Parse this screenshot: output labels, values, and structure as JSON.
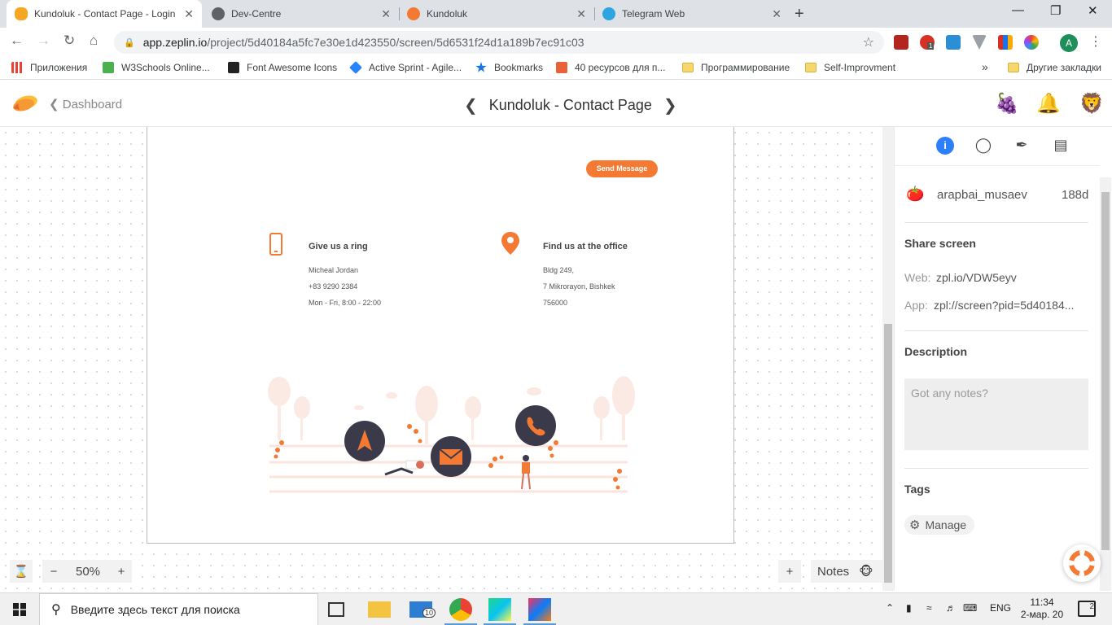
{
  "browser": {
    "tabs": [
      {
        "title": "Kundoluk - Contact Page - Login",
        "close": "✕",
        "active": true
      },
      {
        "title": "Dev-Centre",
        "close": "✕",
        "active": false
      },
      {
        "title": "Kundoluk",
        "close": "✕",
        "active": false
      },
      {
        "title": "Telegram Web",
        "close": "✕",
        "active": false
      }
    ],
    "new_tab": "+",
    "window_controls": {
      "minimize": "—",
      "maximize": "❐",
      "close": "✕"
    },
    "url_host": "app.zeplin.io",
    "url_path": "/project/5d40184a5fc7e30e1d423550/screen/5d6531f24d1a189b7ec91c03",
    "profile_initial": "A",
    "ext_badge": "1",
    "bookmarks": [
      {
        "label": "Приложения"
      },
      {
        "label": "W3Schools Online..."
      },
      {
        "label": "Font Awesome Icons"
      },
      {
        "label": "Active Sprint - Agile..."
      },
      {
        "label": "Bookmarks"
      },
      {
        "label": "40 ресурсов для п..."
      },
      {
        "label": "Программирование"
      },
      {
        "label": "Self-Improvment"
      }
    ],
    "bookmarks_overflow": "»",
    "other_bookmarks": "Другие закладки"
  },
  "zeplin": {
    "back_label": "Dashboard",
    "screen_title": "Kundoluk - Contact Page"
  },
  "artboard": {
    "send_button": "Send Message",
    "ring": {
      "title": "Give us a ring",
      "lines": [
        "Micheal Jordan",
        "+83 9290 2384",
        "Mon - Fri, 8:00 - 22:00"
      ]
    },
    "office": {
      "title": "Find us at the office",
      "lines": [
        "Bldg 249,",
        "7 Mikrorayon, Bishkek",
        "756000"
      ]
    }
  },
  "zoom": {
    "minus": "−",
    "value": "50%",
    "plus": "+"
  },
  "notes_control": {
    "plus": "+",
    "label": "Notes"
  },
  "sidebar": {
    "user": "arapbai_musaev",
    "age": "188d",
    "share_title": "Share screen",
    "web_label": "Web:",
    "web_value": "zpl.io/VDW5eyv",
    "app_label": "App:",
    "app_value": "zpl://screen?pid=5d40184...",
    "description_title": "Description",
    "notes_placeholder": "Got any notes?",
    "tags_title": "Tags",
    "manage_label": "Manage"
  },
  "taskbar": {
    "search_placeholder": "Введите здесь текст для поиска",
    "mail_badge": "10",
    "language": "ENG",
    "time": "11:34",
    "date": "2-мар. 20",
    "notification_count": "2"
  },
  "colors": {
    "accent_orange": "#f47932",
    "zeplin_blue": "#2d7ff9",
    "dark_circle": "#3a3a4a"
  }
}
